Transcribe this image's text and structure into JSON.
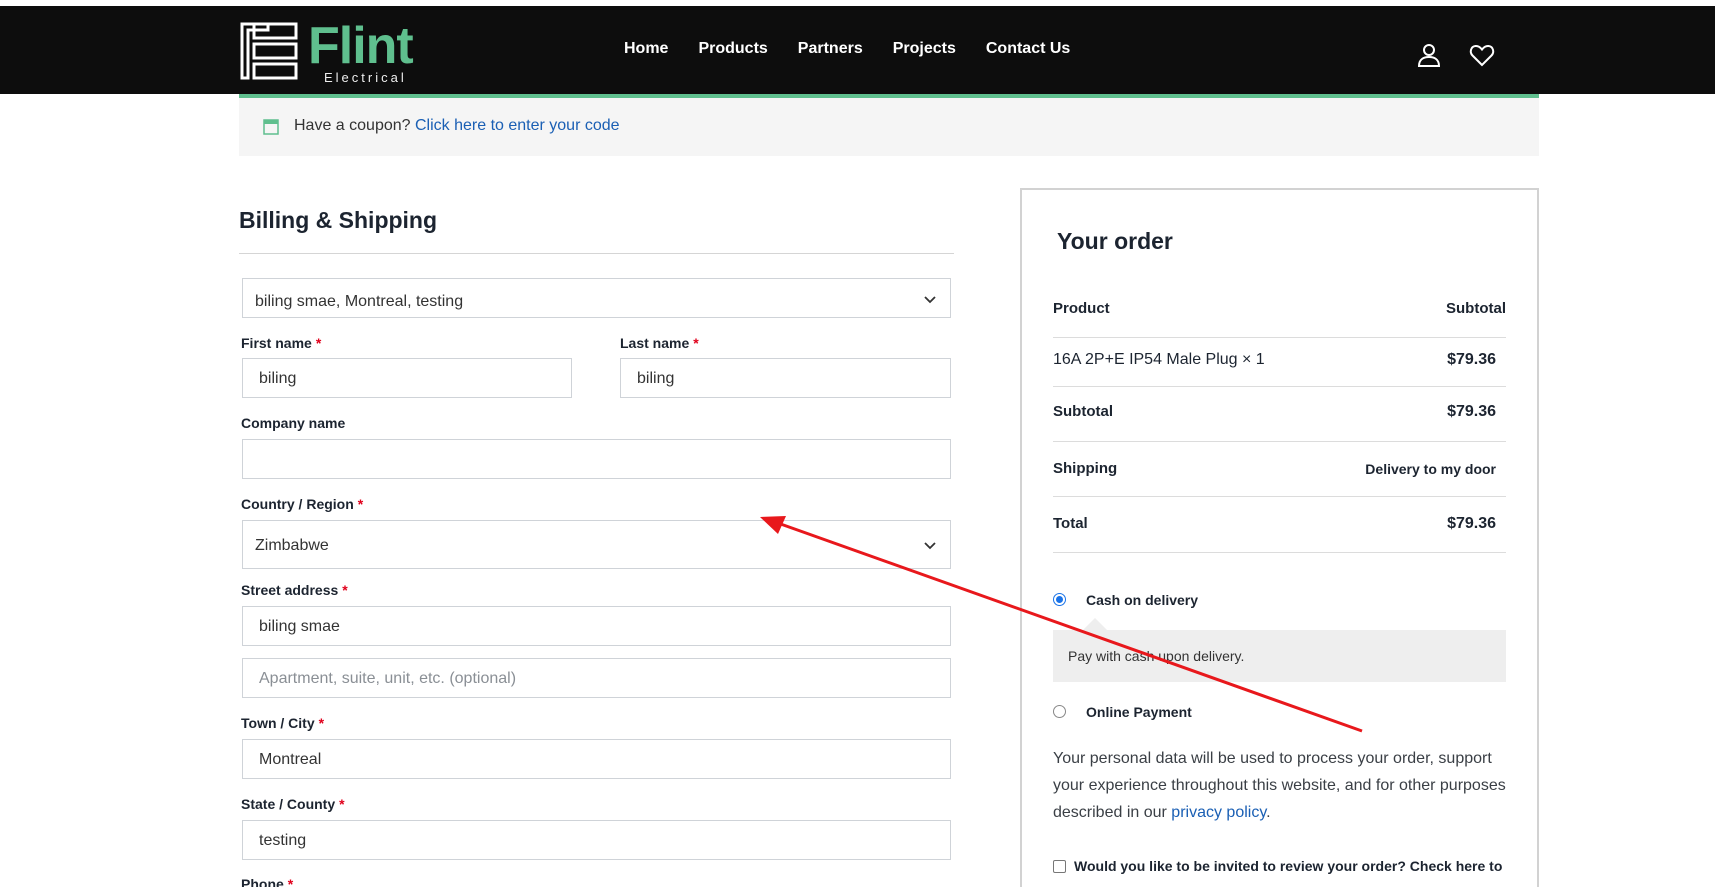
{
  "header": {
    "logo_word": "Flint",
    "logo_sub": "Electrical",
    "nav": [
      "Home",
      "Products",
      "Partners",
      "Projects",
      "Contact Us"
    ],
    "icons": [
      "user-icon",
      "heart-icon"
    ]
  },
  "coupon": {
    "prefix": "Have a coupon?",
    "link": "Click here to enter your code",
    "icon": "calendar-icon"
  },
  "billing": {
    "title": "Billing & Shipping",
    "saved_address": "biling smae, Montreal, testing",
    "first_name": {
      "label": "First name",
      "value": "biling"
    },
    "last_name": {
      "label": "Last name",
      "value": "biling"
    },
    "company": {
      "label": "Company name",
      "value": ""
    },
    "country": {
      "label": "Country / Region",
      "value": "Zimbabwe"
    },
    "street": {
      "label": "Street address",
      "value": "biling smae"
    },
    "apartment": {
      "placeholder": "Apartment, suite, unit, etc. (optional)"
    },
    "city": {
      "label": "Town / City",
      "value": "Montreal"
    },
    "state": {
      "label": "State / County",
      "value": "testing"
    },
    "phone": {
      "label": "Phone"
    },
    "required_mark": "*"
  },
  "order": {
    "title": "Your order",
    "col_product": "Product",
    "col_subtotal": "Subtotal",
    "item_name": "16A 2P+E IP54 Male Plug × 1",
    "item_price": "$79.36",
    "subtotal_label": "Subtotal",
    "subtotal_value": "$79.36",
    "shipping_label": "Shipping",
    "shipping_value": "Delivery to my door",
    "total_label": "Total",
    "total_value": "$79.36",
    "payment_cod": "Cash on delivery",
    "payment_cod_desc": "Pay with cash upon delivery.",
    "payment_online": "Online Payment",
    "privacy_text": "Your personal data will be used to process your order, support your experience throughout this website, and for other purposes described in our",
    "privacy_link": "privacy policy",
    "privacy_end": ".",
    "review_text": "Would you like to be invited to review your order? Check here to"
  },
  "colors": {
    "brand": "#5fbf8e",
    "header_bg": "#0d0d0d",
    "link": "#1a5fb4",
    "required": "#e0001b",
    "annotation_arrow": "#e8181c"
  }
}
